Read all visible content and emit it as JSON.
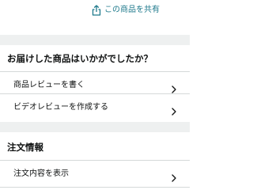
{
  "share": {
    "label": "この商品を共有",
    "icon": "share-icon",
    "color": "#1f7a8c"
  },
  "feedback_section": {
    "title": "お届けした商品はいかがでしたか？",
    "items": [
      {
        "label": "商品レビューを書く",
        "icon": "chevron-right-icon"
      },
      {
        "label": "ビデオレビューを作成する",
        "icon": "chevron-right-icon"
      }
    ]
  },
  "order_section": {
    "title": "注文情報",
    "items": [
      {
        "label": "注文内容を表示",
        "icon": "chevron-right-icon"
      }
    ]
  },
  "colors": {
    "section_divider": "#eef0f0",
    "row_divider": "#d5d9d9",
    "text": "#0f1111"
  }
}
